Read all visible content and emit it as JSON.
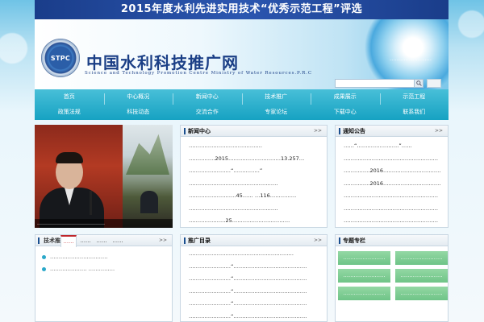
{
  "banner": {
    "text": "2015年度水利先进实用技术“优秀示范工程”评选"
  },
  "header": {
    "logo_text": "STPC",
    "title": "中国水利科技推广网",
    "subtitle": "Science and Technology Promotion Centre Ministry of Water Resources.P.R.C",
    "slogan": "……………………",
    "search": {
      "placeholder": "",
      "value": ""
    }
  },
  "nav": {
    "items": [
      {
        "label": "首页"
      },
      {
        "label": "中心概况"
      },
      {
        "label": "新闻中心"
      },
      {
        "label": "技术推广"
      },
      {
        "label": "成果展示"
      },
      {
        "label": "示范工程"
      },
      {
        "label": "政策法规"
      },
      {
        "label": "科技动态"
      },
      {
        "label": "交流合作"
      },
      {
        "label": "专家论坛"
      },
      {
        "label": "下载中心"
      },
      {
        "label": "联系我们"
      }
    ]
  },
  "photo": {
    "caption": "……………………………………"
  },
  "news_panel": {
    "title": "新闻中心",
    "more": ">>",
    "items": [
      "……………………………………",
      "……………2015…………………………13.257…",
      "……………………“……………”",
      "……………………………………………",
      "………………………45…… …116……………",
      "……………………………………………",
      "…………………25……………………………"
    ]
  },
  "notice_panel": {
    "title": "通知公告",
    "more": ">>",
    "items": [
      "……“……………………”……",
      "……………………………………………………",
      "……………2016………………………………",
      "……………2016………………………………",
      "……………………………………………………",
      "……………………………………………………",
      "……………………………………………………"
    ]
  },
  "tabs_panel": {
    "title": "技术推广",
    "tabs": [
      "……",
      "……",
      "……",
      "……"
    ],
    "more": ">>",
    "items": [
      "……………………………",
      "………………… ……………"
    ]
  },
  "promo_panel": {
    "title": "推广目录",
    "more": ">>",
    "items": [
      "……………………………………………………",
      "……………………“……………………………………",
      "……………………“……………………………………",
      "……………………“……………………………………",
      "……………………“……………………………………",
      "……………………“……………………………………"
    ]
  },
  "links_panel": {
    "title": "专题专栏",
    "buttons": [
      "……………………",
      "……………………",
      "……………………",
      "……………………",
      "……………………",
      "……………………"
    ]
  },
  "colors": {
    "banner": "#1a3d8a",
    "nav": "#16a2c2",
    "accent_red": "#c0262b",
    "link_button": "#6fc487"
  }
}
